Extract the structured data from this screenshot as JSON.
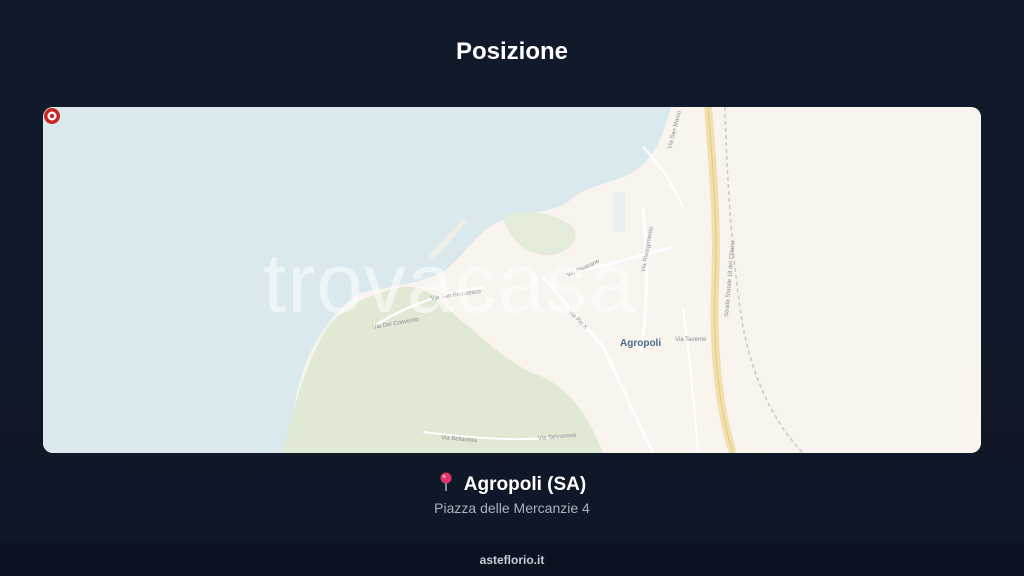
{
  "section_title": "Posizione",
  "map": {
    "watermark": "trovacasa",
    "town_label": "Agropoli",
    "streets": [
      "Via San Francesco",
      "Via Del Convento",
      "Via Pisacane",
      "Via Pio X",
      "Via Risorgimento",
      "Via San Marco",
      "Via Taverne",
      "Via Bellavista",
      "Via Selvanova",
      "Strada Statale 18 del Cilento"
    ]
  },
  "location": {
    "name": "Agropoli (SA)",
    "address": "Piazza delle Mercanzie 4"
  },
  "footer": {
    "site": "asteflorio.it"
  },
  "colors": {
    "background": "#111a2b",
    "sea": "#d9e9ee",
    "land": "#f9f4ee",
    "park": "#dfe9d4",
    "pin": "#c62828"
  },
  "icons": {
    "pin": "pushpin-icon",
    "map_marker": "map-marker-icon"
  }
}
